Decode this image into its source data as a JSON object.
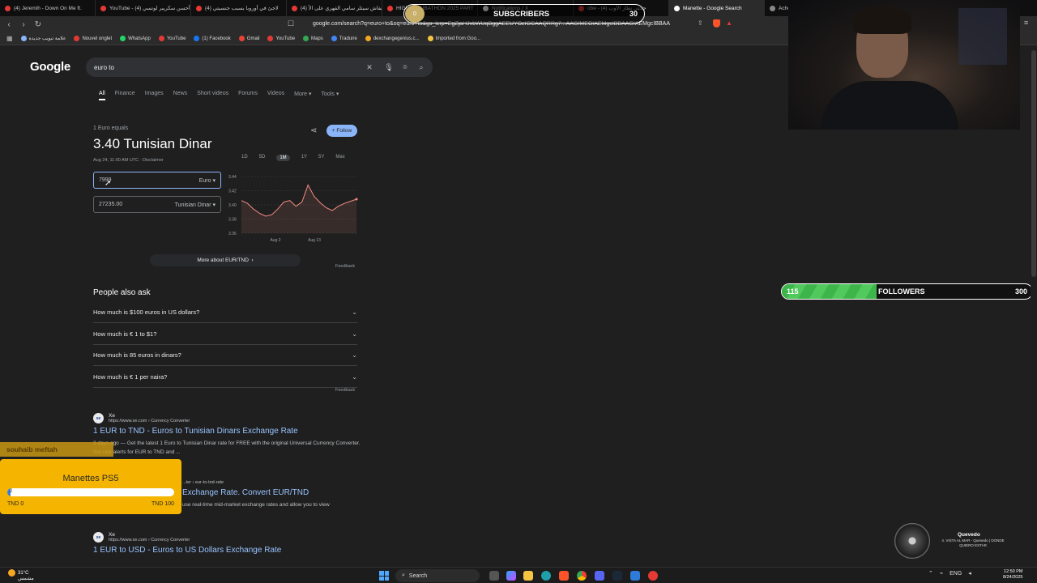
{
  "tabs": [
    {
      "label": "(4) Jeremih - Down On Me ft.",
      "color": "#e53935"
    },
    {
      "label": "YouTube - (4) أحسن سكريبر لونسي",
      "color": "#e53935"
    },
    {
      "label": "(4) لاجئ في أوروبا بسبب جنسيتي",
      "color": "#e53935"
    },
    {
      "label": "(4) كيفاش سيتلر سامي الفهري على الأ",
      "color": "#e53935"
    },
    {
      "label": "HIGH ... SUBATHON 2025 PART",
      "color": "#e53935"
    },
    {
      "label": "Notifications / X",
      "color": "#ffffff"
    },
    {
      "label": "obe - (4) ججتي نطار الأوب",
      "color": "#e53935"
    },
    {
      "label": "Manette - Google Search",
      "color": "#ffffff"
    },
    {
      "label": "Acheter",
      "color": "#888888"
    }
  ],
  "address_bar": {
    "url": "google.com/search?q=euro+to&oq=euro+to&gs_lcrp=EgZjaHJvbWUqBggAEEUYOzIGCAAQRRg7...AAGIMEGIAEMgcIBBAAGIAEMgcIBBAA"
  },
  "bookmarks": [
    {
      "label": "علامة تبويب جديدة",
      "color": "#8ab4f8"
    },
    {
      "label": "Nouvel onglet",
      "color": "#e53935"
    },
    {
      "label": "WhatsApp",
      "color": "#25d366"
    },
    {
      "label": "YouTube",
      "color": "#e53935"
    },
    {
      "label": "(1) Facebook",
      "color": "#1877f2"
    },
    {
      "label": "Gmail",
      "color": "#ea4335"
    },
    {
      "label": "YouTube",
      "color": "#e53935"
    },
    {
      "label": "Maps",
      "color": "#34a853"
    },
    {
      "label": "Traduire",
      "color": "#4285f4"
    },
    {
      "label": "dexchangegenius.c...",
      "color": "#f5a623"
    },
    {
      "label": "Imported from Goo...",
      "color": "#f5c542"
    }
  ],
  "google": {
    "logo": "Google",
    "query": "euro to",
    "nav_tabs": [
      "All",
      "Finance",
      "Images",
      "News",
      "Short videos",
      "Forums",
      "Videos",
      "More ▾",
      "Tools ▾"
    ]
  },
  "converter": {
    "equals_label": "1 Euro equals",
    "title": "3.40 Tunisian Dinar",
    "timestamp": "Aug 24, 11:00 AM UTC · Disclaimer",
    "follow_label": "+ Follow",
    "from_value": "7999",
    "from_currency": "Euro",
    "to_value": "27235.00",
    "to_currency": "Tunisian Dinar",
    "more_about": "More about EUR/TND",
    "feedback": "Feedback"
  },
  "chart_data": {
    "type": "line",
    "ranges": [
      "1D",
      "5D",
      "1M",
      "1Y",
      "5Y",
      "Max"
    ],
    "selected_range": "1M",
    "y_ticks": [
      "3.44",
      "3.42",
      "3.40",
      "3.38",
      "3.36"
    ],
    "ylim": [
      3.36,
      3.44
    ],
    "x_ticks": [
      "Aug 2",
      "Aug 13"
    ],
    "values": [
      3.406,
      3.402,
      3.394,
      3.388,
      3.384,
      3.386,
      3.394,
      3.404,
      3.406,
      3.398,
      3.404,
      3.428,
      3.412,
      3.403,
      3.396,
      3.392,
      3.398,
      3.402,
      3.405,
      3.408
    ],
    "line_color": "#f28b82"
  },
  "people_also_ask": {
    "title": "People also ask",
    "questions": [
      "How much is $100 euros in US dollars?",
      "How much is € 1 to $1?",
      "How much is 85 euros in dinars?",
      "How much is € 1 per naira?"
    ],
    "feedback": "Feedback"
  },
  "results": [
    {
      "site": "Xe",
      "url": "https://www.xe.com › Currency Converter",
      "title": "1 EUR to TND - Euros to Tunisian Dinars Exchange Rate",
      "snippet": "3 days ago — Get the latest 1 Euro to Tunisian Dinar rate for FREE with the original Universal Currency Converter. Set rate alerts for EUR to TND and ..."
    },
    {
      "site": "",
      "url": "...ter › eur-to-tnd-rate",
      "title": "Exchange Rate. Convert EUR/TND",
      "snippet": "use real-time mid-market exchange rates and allow you to view"
    },
    {
      "site": "Xe",
      "url": "https://www.xe.com › Currency Converter",
      "title": "1 EUR to USD - Euros to US Dollars Exchange Rate",
      "snippet": ""
    }
  ],
  "overlays": {
    "subscribers": {
      "current": "0",
      "label": "SUBSCRIBERS",
      "goal": "30"
    },
    "followers": {
      "current": "115",
      "label": "FOLLOWERS",
      "goal": "300",
      "fraction": 0.38
    },
    "donor": "souhaib meftah",
    "goal_widget": {
      "title": "Manettes PS5",
      "value": "2",
      "fraction": 0.02,
      "min_label": "TND 0",
      "max_label": "TND 100"
    },
    "now_playing": {
      "artist": "Quevedo",
      "track": "4. VISTA AL MAR - Quevedo | DONDE QUIERO ESTAR"
    }
  },
  "taskbar": {
    "weather_temp": "31°C",
    "weather_desc": "مشمس",
    "search": "Search",
    "lang": "ENG",
    "time": "12:50 PM",
    "date": "8/24/2025"
  }
}
